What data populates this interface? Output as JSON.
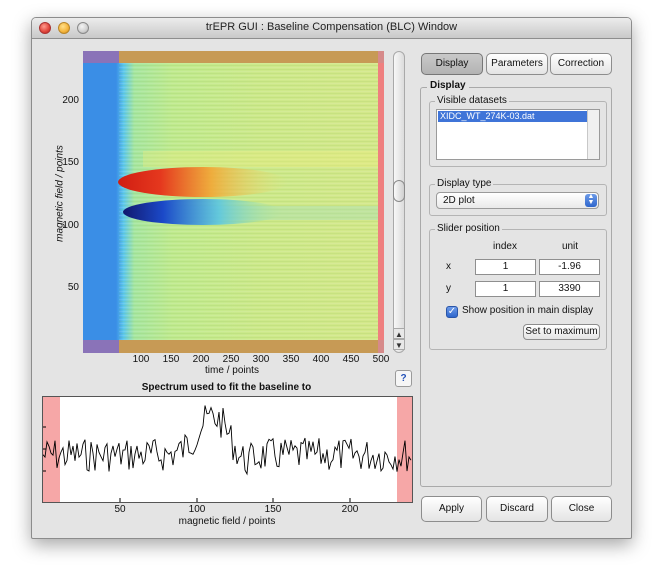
{
  "window": {
    "title": "trEPR GUI : Baseline Compensation (BLC) Window"
  },
  "plot2d": {
    "ylabel": "magnetic field / points",
    "xlabel": "time / points",
    "yticks": [
      "200",
      "150",
      "100",
      "50"
    ],
    "xticks": [
      "100",
      "150",
      "200",
      "250",
      "300",
      "350",
      "400",
      "450",
      "500"
    ]
  },
  "spectrum": {
    "title": "Spectrum used to fit the baseline to",
    "xlabel": "magnetic field / points",
    "xticks": [
      "50",
      "100",
      "150",
      "200"
    ]
  },
  "help": {
    "label": "?"
  },
  "tabs": [
    {
      "label": "Display"
    },
    {
      "label": "Parameters"
    },
    {
      "label": "Correction"
    }
  ],
  "display_panel": {
    "title": "Display",
    "visible_datasets": {
      "title": "Visible datasets",
      "items": [
        "XIDC_WT_274K-03.dat"
      ]
    },
    "display_type": {
      "title": "Display type",
      "value": "2D plot"
    },
    "slider_position": {
      "title": "Slider position",
      "col_index": "index",
      "col_unit": "unit",
      "x_label": "x",
      "y_label": "y",
      "x_index": "1",
      "x_unit": "-1.96",
      "y_index": "1",
      "y_unit": "3390",
      "show_position_label": "Show position in main display",
      "set_max_label": "Set to maximum"
    }
  },
  "footer": {
    "apply": "Apply",
    "discard": "Discard",
    "close": "Close"
  },
  "colors": {
    "accent": "#3f74d8",
    "excluded_region": "#f6a7a7"
  }
}
